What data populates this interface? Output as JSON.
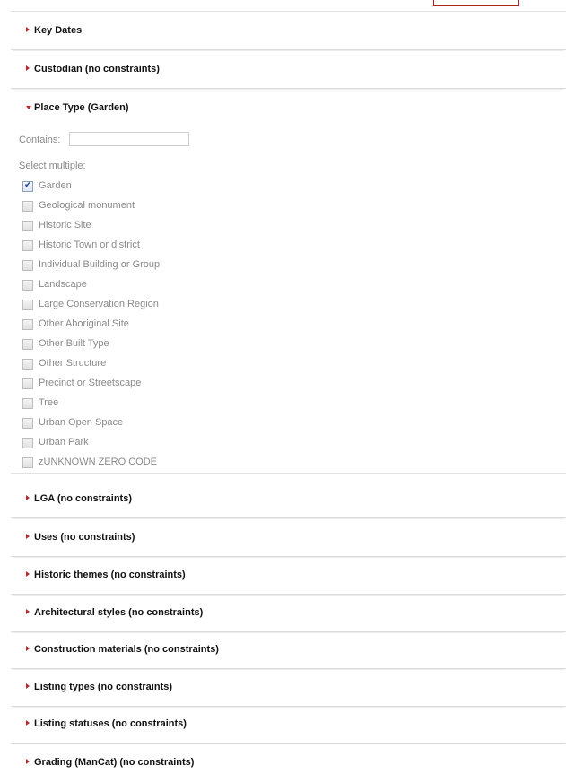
{
  "panels_before": [
    {
      "label": "Key Dates"
    },
    {
      "label": "Custodian (no constraints)"
    }
  ],
  "open_panel": {
    "label": "Place Type (Garden)",
    "contains_label": "Contains:",
    "contains_value": "",
    "select_multiple_label": "Select multiple:",
    "options": [
      {
        "label": "Garden",
        "checked": true
      },
      {
        "label": "Geological monument",
        "checked": false
      },
      {
        "label": "Historic Site",
        "checked": false
      },
      {
        "label": "Historic Town or district",
        "checked": false
      },
      {
        "label": "Individual Building or Group",
        "checked": false
      },
      {
        "label": "Landscape",
        "checked": false
      },
      {
        "label": "Large Conservation Region",
        "checked": false
      },
      {
        "label": "Other Aboriginal Site",
        "checked": false
      },
      {
        "label": "Other Built Type",
        "checked": false
      },
      {
        "label": "Other Structure",
        "checked": false
      },
      {
        "label": "Precinct or Streetscape",
        "checked": false
      },
      {
        "label": "Tree",
        "checked": false
      },
      {
        "label": "Urban Open Space",
        "checked": false
      },
      {
        "label": "Urban Park",
        "checked": false
      },
      {
        "label": "zUNKNOWN ZERO CODE",
        "checked": false
      }
    ]
  },
  "panels_after": [
    {
      "label": "LGA (no constraints)"
    },
    {
      "label": "Uses (no constraints)"
    },
    {
      "label": "Historic themes (no constraints)"
    },
    {
      "label": "Architectural styles (no constraints)"
    },
    {
      "label": "Construction materials (no constraints)"
    },
    {
      "label": "Listing types (no constraints)"
    },
    {
      "label": "Listing statuses (no constraints)"
    },
    {
      "label": "Grading (ManCat) (no constraints)"
    }
  ],
  "colors": {
    "accent": "#c0262c",
    "heading_text": "#111111",
    "muted_text": "#8a8a8a",
    "divider": "#dcdcdc",
    "checkbox_tick": "#2a4f95"
  }
}
